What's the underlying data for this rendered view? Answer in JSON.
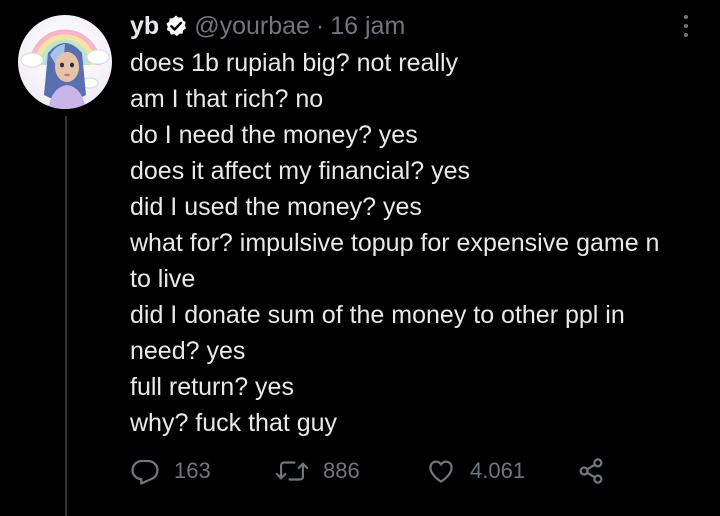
{
  "author": {
    "display_name": "yb",
    "handle": "@yourbae",
    "separator": "·",
    "timestamp": "16 jam",
    "verified": true,
    "avatar_icon": "avatar-image"
  },
  "tweet": {
    "lines": [
      "does 1b rupiah big? not really",
      "am I that rich? no",
      "do I need the money? yes",
      "does it affect my financial? yes",
      "did I used the money? yes",
      "what for? impulsive topup for expensive game n",
      "to live",
      "did I donate sum of the money to other ppl in",
      "need? yes",
      "full return? yes",
      "why? fuck that guy"
    ]
  },
  "actions": {
    "replies": "163",
    "retweets": "886",
    "likes": "4.061"
  },
  "colors": {
    "background": "#000000",
    "text": "#e7e9ea",
    "secondary": "#71767b",
    "verified_badge": "#ffffff",
    "thread_line": "#333639"
  }
}
